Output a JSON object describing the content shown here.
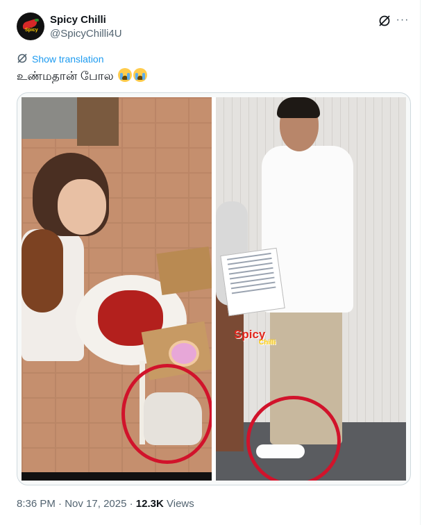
{
  "author": {
    "name": "Spicy Chilli",
    "handle": "@SpicyChilli4U",
    "avatar_text": "Spicy"
  },
  "actions": {
    "grok_icon": "grok-icon",
    "more_icon": "more-icon",
    "more_glyph": "···"
  },
  "translation": {
    "label": "Show translation",
    "icon": "translate-icon"
  },
  "tweet": {
    "text": "உண்மதான் போல"
  },
  "media": {
    "watermark": "Spicy",
    "watermark_sub": "Chilli",
    "circle_color": "#d1132b"
  },
  "footer": {
    "time": "8:36 PM",
    "separator": "·",
    "date": "Nov 17, 2025",
    "views_count": "12.3K",
    "views_label": "Views"
  },
  "colors": {
    "link": "#1d9bf0",
    "secondary_text": "#536471",
    "primary_text": "#0f1419",
    "border": "#cfd9de"
  }
}
